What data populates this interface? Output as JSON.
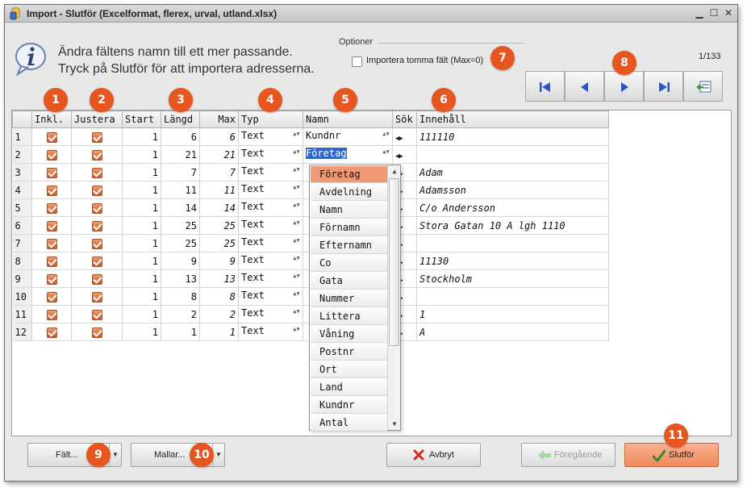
{
  "window": {
    "title": "Import - Slutför  (Excelformat, flerex, urval, utland.xlsx)"
  },
  "header": {
    "instruction_line1": "Ändra fältens namn till ett mer passande.",
    "instruction_line2": "Tryck på Slutför för att importera adresserna.",
    "options_label": "Optioner",
    "import_empty_label": "Importera tomma fält (Max=0)",
    "import_empty_checked": false,
    "record_counter": "1/133"
  },
  "badges": [
    "1",
    "2",
    "3",
    "4",
    "5",
    "6",
    "7",
    "8",
    "9",
    "10",
    "11"
  ],
  "grid": {
    "columns": [
      "Inkl.",
      "Justera",
      "Start",
      "Längd",
      "Max",
      "Typ",
      "Namn",
      "Sök",
      "Innehåll"
    ],
    "rows": [
      {
        "n": "1",
        "incl": true,
        "just": true,
        "start": "1",
        "len": "6",
        "max": "6",
        "typ": "Text",
        "namn": "Kundnr",
        "inh": "111110"
      },
      {
        "n": "2",
        "incl": true,
        "just": true,
        "start": "1",
        "len": "21",
        "max": "21",
        "typ": "Text",
        "namn": "Företag",
        "inh": ""
      },
      {
        "n": "3",
        "incl": true,
        "just": true,
        "start": "1",
        "len": "7",
        "max": "7",
        "typ": "Text",
        "namn": "",
        "inh": "Adam"
      },
      {
        "n": "4",
        "incl": true,
        "just": true,
        "start": "1",
        "len": "11",
        "max": "11",
        "typ": "Text",
        "namn": "",
        "inh": "Adamsson"
      },
      {
        "n": "5",
        "incl": true,
        "just": true,
        "start": "1",
        "len": "14",
        "max": "14",
        "typ": "Text",
        "namn": "",
        "inh": "C/o Andersson"
      },
      {
        "n": "6",
        "incl": true,
        "just": true,
        "start": "1",
        "len": "25",
        "max": "25",
        "typ": "Text",
        "namn": "",
        "inh": "Stora Gatan 10 A lgh 1110"
      },
      {
        "n": "7",
        "incl": true,
        "just": true,
        "start": "1",
        "len": "25",
        "max": "25",
        "typ": "Text",
        "namn": "",
        "inh": ""
      },
      {
        "n": "8",
        "incl": true,
        "just": true,
        "start": "1",
        "len": "9",
        "max": "9",
        "typ": "Text",
        "namn": "",
        "inh": "11130"
      },
      {
        "n": "9",
        "incl": true,
        "just": true,
        "start": "1",
        "len": "13",
        "max": "13",
        "typ": "Text",
        "namn": "",
        "inh": "Stockholm"
      },
      {
        "n": "10",
        "incl": true,
        "just": true,
        "start": "1",
        "len": "8",
        "max": "8",
        "typ": "Text",
        "namn": "",
        "inh": ""
      },
      {
        "n": "11",
        "incl": true,
        "just": true,
        "start": "1",
        "len": "2",
        "max": "2",
        "typ": "Text",
        "namn": "",
        "inh": "1"
      },
      {
        "n": "12",
        "incl": true,
        "just": true,
        "start": "1",
        "len": "1",
        "max": "1",
        "typ": "Text",
        "namn": "",
        "inh": "A"
      }
    ]
  },
  "dropdown": {
    "selected": "Företag",
    "items": [
      "Företag",
      "Avdelning",
      "Namn",
      "Förnamn",
      "Efternamn",
      "Co",
      "Gata",
      "Nummer",
      "Littera",
      "Våning",
      "Postnr",
      "Ort",
      "Land",
      "Kundnr",
      "Antal"
    ]
  },
  "footer": {
    "falt_label": "Fält...",
    "mallar_label": "Mallar...",
    "avbryt_label": "Avbryt",
    "foregaende_label": "Föregående",
    "slutfor_label": "Slutför"
  },
  "colors": {
    "accent": "#e8561f",
    "primary_button": "#f08a5d",
    "value_text": "#1d2a8c",
    "selection": "#2f65c8"
  }
}
